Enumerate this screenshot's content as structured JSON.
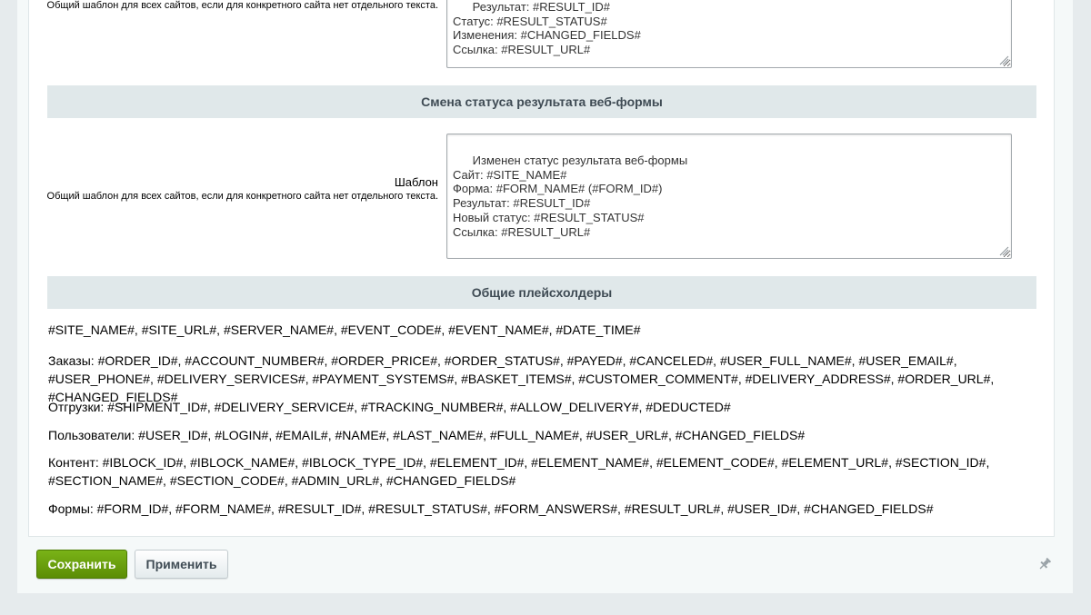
{
  "templates": [
    {
      "label_main": "",
      "label_note": "Общий шаблон для всех сайтов, если для конкретного сайта нет отдельного текста.",
      "value": "Результат: #RESULT_ID#\nСтатус: #RESULT_STATUS#\nИзменения: #CHANGED_FIELDS#\nСсылка: #RESULT_URL#"
    },
    {
      "section_title": "Смена статуса результата веб-формы",
      "label_main": "Шаблон",
      "label_note": "Общий шаблон для всех сайтов, если для конкретного сайта нет отдельного текста.",
      "value": "Изменен статус результата веб-формы\nСайт: #SITE_NAME#\nФорма: #FORM_NAME# (#FORM_ID#)\nРезультат: #RESULT_ID#\nНовый статус: #RESULT_STATUS#\nСсылка: #RESULT_URL#"
    }
  ],
  "placeholders": {
    "section_title": "Общие плейсхолдеры",
    "common": "#SITE_NAME#, #SITE_URL#, #SERVER_NAME#, #EVENT_CODE#, #EVENT_NAME#, #DATE_TIME#",
    "orders": "Заказы: #ORDER_ID#, #ACCOUNT_NUMBER#, #ORDER_PRICE#, #ORDER_STATUS#, #PAYED#, #CANCELED#, #USER_FULL_NAME#, #USER_EMAIL#, #USER_PHONE#, #DELIVERY_SERVICES#, #PAYMENT_SYSTEMS#, #BASKET_ITEMS#, #CUSTOMER_COMMENT#, #DELIVERY_ADDRESS#, #ORDER_URL#, #CHANGED_FIELDS#",
    "shipments": "Отгрузки: #SHIPMENT_ID#, #DELIVERY_SERVICE#, #TRACKING_NUMBER#, #ALLOW_DELIVERY#, #DEDUCTED#",
    "users": "Пользователи: #USER_ID#, #LOGIN#, #EMAIL#, #NAME#, #LAST_NAME#, #FULL_NAME#, #USER_URL#, #CHANGED_FIELDS#",
    "content": "Контент: #IBLOCK_ID#, #IBLOCK_NAME#, #IBLOCK_TYPE_ID#, #ELEMENT_ID#, #ELEMENT_NAME#, #ELEMENT_CODE#, #ELEMENT_URL#, #SECTION_ID#, #SECTION_NAME#, #SECTION_CODE#, #ADMIN_URL#, #CHANGED_FIELDS#",
    "forms": "Формы: #FORM_ID#, #FORM_NAME#, #RESULT_ID#, #RESULT_STATUS#, #FORM_ANSWERS#, #RESULT_URL#, #USER_ID#, #CHANGED_FIELDS#"
  },
  "buttons": {
    "save": "Сохранить",
    "apply": "Применить"
  },
  "icons": {
    "pin": "pin-icon",
    "resize": "resize-grip-icon"
  },
  "colors": {
    "save_button": "#6da10f",
    "section_header_bg": "#e0e8ea",
    "page_bg": "#e6ebed"
  }
}
